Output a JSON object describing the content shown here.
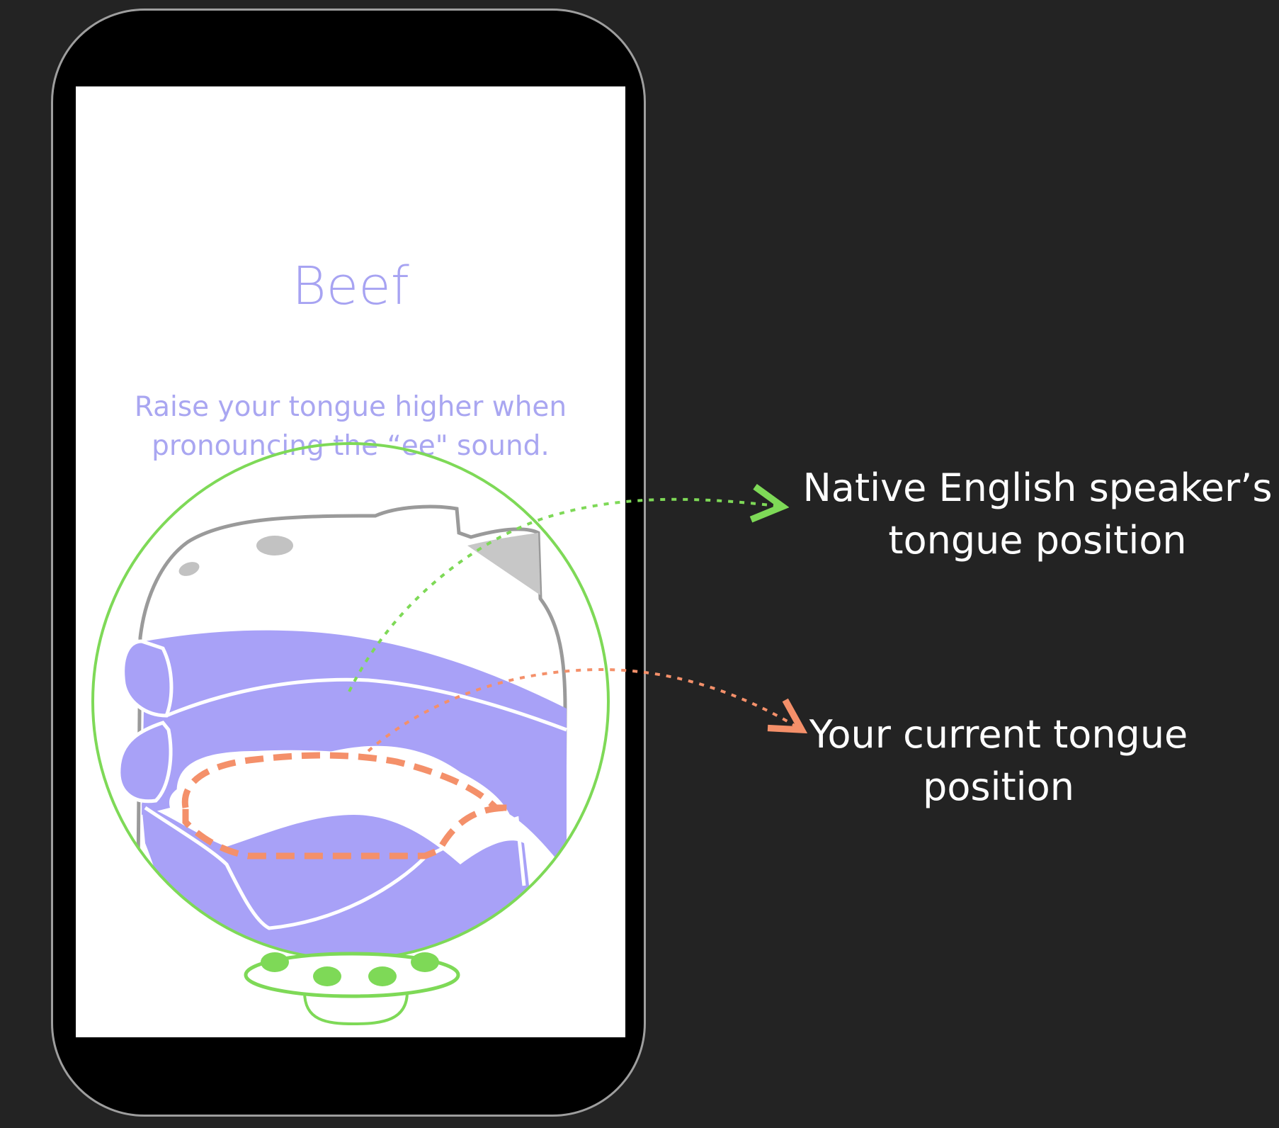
{
  "screen": {
    "word": "Beef",
    "instruction_lines": [
      "Raise your tongue higher when",
      "pronouncing the “ee\" sound."
    ]
  },
  "callouts": {
    "native": {
      "lines": [
        "Native English speaker’s",
        "tongue position"
      ],
      "color": "#7ed957"
    },
    "current": {
      "lines": [
        "Your current tongue",
        "position"
      ],
      "color": "#f4906a"
    }
  },
  "colors": {
    "background": "#232323",
    "accent_purple": "#a7a3f2",
    "mouth_fill": "#a8a1f7",
    "lens_ring": "#7ed957",
    "current_tongue": "#f4906a"
  }
}
